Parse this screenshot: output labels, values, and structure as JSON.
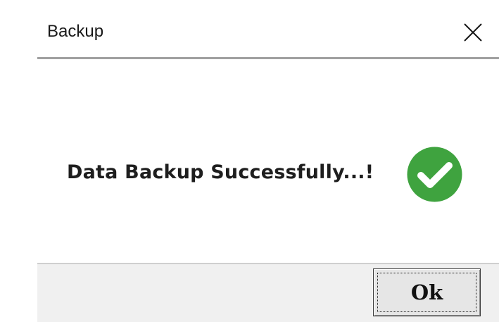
{
  "window": {
    "title": "Backup",
    "close_icon": "close-icon"
  },
  "message": {
    "text": "Data Backup Successfully...!",
    "icon": "check-circle-icon",
    "icon_color": "#3fa33f"
  },
  "footer": {
    "ok_label": "Ok"
  }
}
